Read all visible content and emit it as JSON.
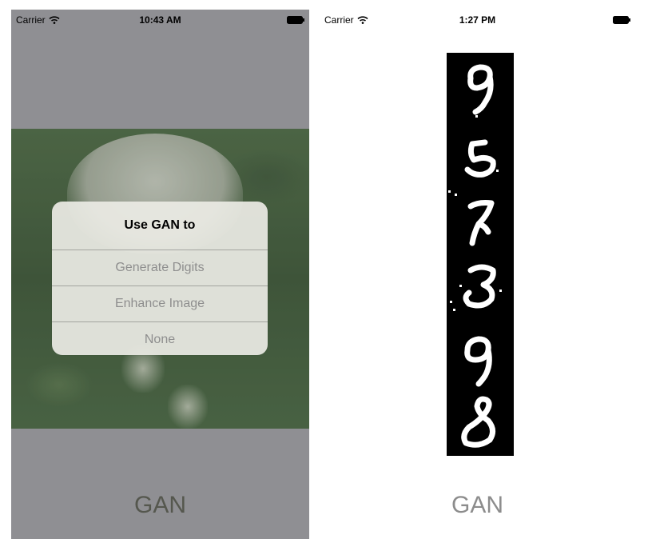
{
  "left_screen": {
    "status_bar": {
      "carrier": "Carrier",
      "time": "10:43 AM"
    },
    "alert": {
      "title": "Use GAN to",
      "buttons": [
        "Generate Digits",
        "Enhance Image",
        "None"
      ]
    },
    "bottom_label": "GAN"
  },
  "right_screen": {
    "status_bar": {
      "carrier": "Carrier",
      "time": "1:27 PM"
    },
    "digits": [
      "9",
      "5",
      "7",
      "3",
      "9",
      "8"
    ],
    "bottom_label": "GAN"
  },
  "colors": {
    "dim_background": "#8f8f93",
    "alert_button_text": "#8e8e8e",
    "digit_background": "#000000",
    "digit_stroke": "#ffffff"
  },
  "icons": [
    "wifi-icon",
    "battery-icon"
  ]
}
